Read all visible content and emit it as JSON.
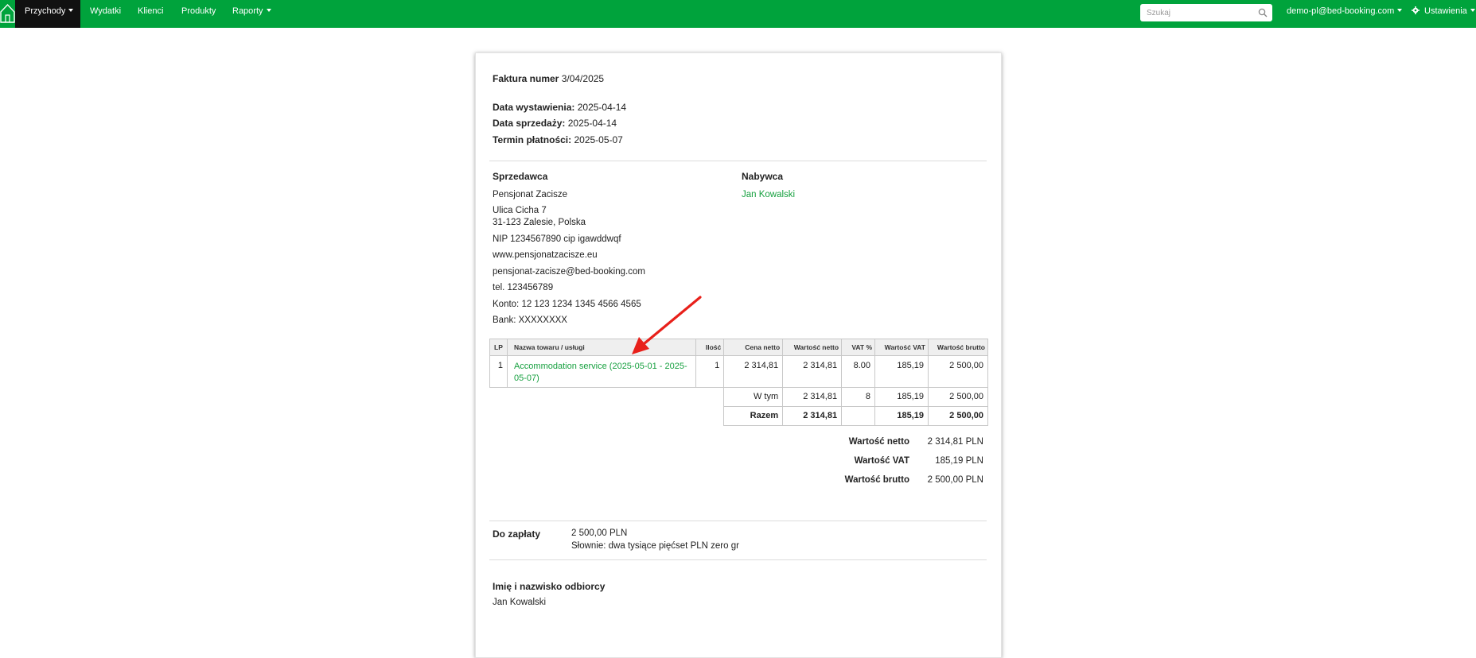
{
  "nav": {
    "home_icon": "house-icon",
    "items": [
      {
        "label": "Przychody",
        "has_caret": true,
        "active": true
      },
      {
        "label": "Wydatki",
        "has_caret": false
      },
      {
        "label": "Klienci",
        "has_caret": false
      },
      {
        "label": "Produkty",
        "has_caret": false
      },
      {
        "label": "Raporty",
        "has_caret": true
      }
    ],
    "search_placeholder": "Szukaj",
    "user_email": "demo-pl@bed-booking.com",
    "settings_label": "Ustawienia",
    "bar_color": "#00a33c"
  },
  "invoice": {
    "title_label": "Faktura numer",
    "number": "3/04/2025",
    "issue_date_label": "Data wystawienia:",
    "issue_date": "2025-04-14",
    "sale_date_label": "Data sprzedaży:",
    "sale_date": "2025-04-14",
    "due_date_label": "Termin płatności:",
    "due_date": "2025-05-07",
    "seller": {
      "heading": "Sprzedawca",
      "name": "Pensjonat Zacisze",
      "street": "Ulica Cicha 7",
      "city": "31-123 Zalesie, Polska",
      "nip": "NIP 1234567890 cip igawddwqf",
      "www": "www.pensjonatzacisze.eu",
      "email": "pensjonat-zacisze@bed-booking.com",
      "phone": "tel. 123456789",
      "account": "Konto: 12 123 1234 1345 4566 4565",
      "bank": "Bank: XXXXXXXX"
    },
    "buyer": {
      "heading": "Nabywca",
      "name": "Jan Kowalski"
    },
    "table_headers": [
      "LP",
      "Nazwa towaru / usługi",
      "Ilość",
      "Cena netto",
      "Wartość netto",
      "VAT %",
      "Wartość VAT",
      "Wartość brutto"
    ],
    "items": [
      {
        "lp": "1",
        "name": "Accommodation service (2025-05-01 - 2025-05-07)",
        "qty": "1",
        "unit_net": "2 314,81",
        "net": "2 314,81",
        "vat_pct": "8.00",
        "vat": "185,19",
        "gross": "2 500,00"
      }
    ],
    "wtym": {
      "label": "W tym",
      "net": "2 314,81",
      "vat_pct": "8",
      "vat": "185,19",
      "gross": "2 500,00"
    },
    "razem": {
      "label": "Razem",
      "net": "2 314,81",
      "vat_pct": "",
      "vat": "185,19",
      "gross": "2 500,00"
    },
    "totals": [
      {
        "label": "Wartość netto",
        "value": "2 314,81 PLN"
      },
      {
        "label": "Wartość VAT",
        "value": "185,19 PLN"
      },
      {
        "label": "Wartość brutto",
        "value": "2 500,00 PLN"
      }
    ],
    "to_pay_label": "Do zapłaty",
    "to_pay_value": "2 500,00 PLN",
    "to_pay_words": "Słownie: dwa tysiące pięćset PLN zero gr",
    "recipient_label": "Imię i nazwisko odbiorcy",
    "recipient_name": "Jan Kowalski",
    "link_color": "#16a03f",
    "annotation_arrow_color": "#e8201a"
  }
}
